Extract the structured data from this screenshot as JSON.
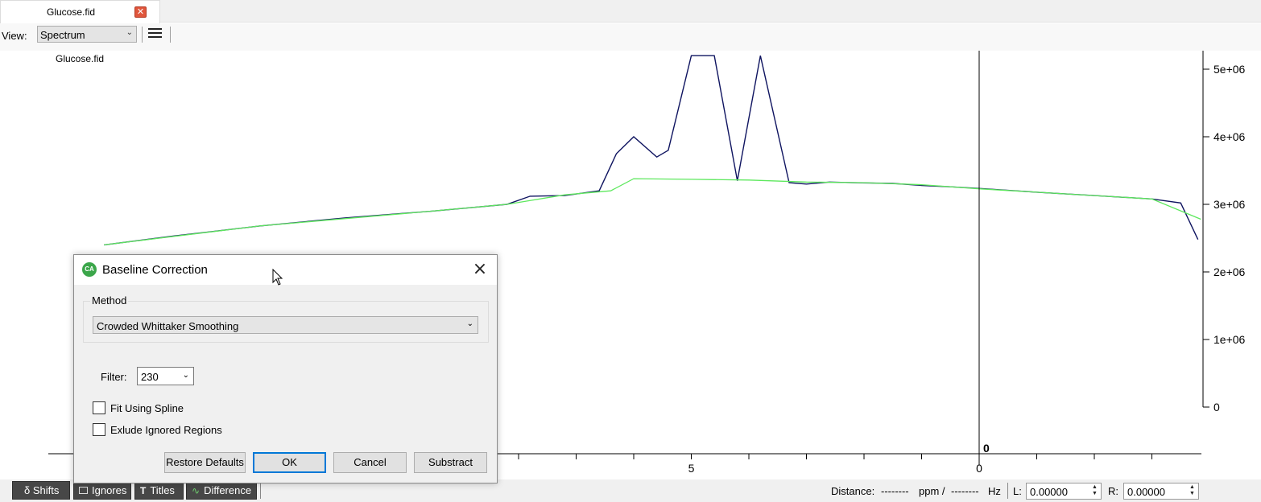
{
  "tab": {
    "label": "Glucose.fid",
    "close_icon": "close-icon"
  },
  "toolbar": {
    "view_label": "View:",
    "view_value": "Spectrum",
    "menu_icon": "hamburger-menu-icon"
  },
  "plot": {
    "title": "Glucose.fid",
    "zero_marker": "0",
    "colors": {
      "spectrum": "#0f1460",
      "baseline": "#5ee85e",
      "axis": "#000000"
    }
  },
  "chart_data": {
    "type": "line",
    "title": "Glucose.fid",
    "xlabel": "",
    "ylabel": "",
    "x_reversed": true,
    "x_ticks": [
      "5",
      "0"
    ],
    "y_ticks": [
      "5e+06",
      "4e+06",
      "3e+06",
      "2e+06",
      "1e+06",
      "0"
    ],
    "ylim": [
      0,
      5200000
    ],
    "xlim": [
      15.3,
      -3.85
    ],
    "series": [
      {
        "role": "spectrum",
        "x": [
          15.2,
          14.0,
          12.5,
          11.0,
          9.5,
          8.2,
          7.8,
          7.2,
          6.6,
          6.3,
          6.0,
          5.6,
          5.4,
          5.0,
          4.6,
          4.2,
          3.8,
          3.3,
          3.0,
          2.6,
          2.2,
          1.5,
          1.0,
          0.5,
          0.1,
          -0.1,
          -1.0,
          -2.0,
          -3.0,
          -3.5,
          -3.8
        ],
        "y": [
          2400000,
          2530000,
          2680000,
          2800000,
          2900000,
          3000000,
          3120000,
          3130000,
          3200000,
          3750000,
          4000000,
          3700000,
          3800000,
          5200000,
          5200000,
          3350000,
          5200000,
          3320000,
          3300000,
          3330000,
          3320000,
          3310000,
          3280000,
          3260000,
          3240000,
          3230000,
          3180000,
          3130000,
          3080000,
          3020000,
          2480000
        ]
      },
      {
        "role": "baseline",
        "x": [
          15.2,
          12.5,
          9.5,
          8.2,
          7.2,
          6.4,
          6.0,
          5.0,
          4.0,
          3.0,
          2.0,
          1.0,
          0.0,
          -1.0,
          -2.0,
          -3.0,
          -3.85
        ],
        "y": [
          2400000,
          2680000,
          2900000,
          3000000,
          3140000,
          3200000,
          3380000,
          3370000,
          3360000,
          3330000,
          3320000,
          3290000,
          3230000,
          3180000,
          3130000,
          3080000,
          2780000
        ]
      }
    ],
    "grid": false,
    "legend": "none"
  },
  "statusbar": {
    "shifts": "δ Shifts",
    "ignores": "Ignores",
    "titles": "Titles",
    "difference": "Difference",
    "distance_label": "Distance:",
    "distance_ppm": "--------",
    "ppm_unit": "ppm /",
    "distance_hz": "--------",
    "hz_unit": "Hz",
    "l_label": "L:",
    "l_value": "0.00000",
    "r_label": "R:",
    "r_value": "0.00000"
  },
  "dialog": {
    "title": "Baseline Correction",
    "app_icon_text": "CA",
    "method_legend": "Method",
    "method_value": "Crowded Whittaker Smoothing",
    "filter_label": "Filter:",
    "filter_value": "230",
    "fit_spline_label": "Fit Using Spline",
    "fit_spline_checked": false,
    "exclude_ignored_label": "Exlude Ignored Regions",
    "exclude_ignored_checked": false,
    "buttons": {
      "restore_defaults": "Restore Defaults",
      "ok": "OK",
      "cancel": "Cancel",
      "substract": "Substract"
    }
  }
}
